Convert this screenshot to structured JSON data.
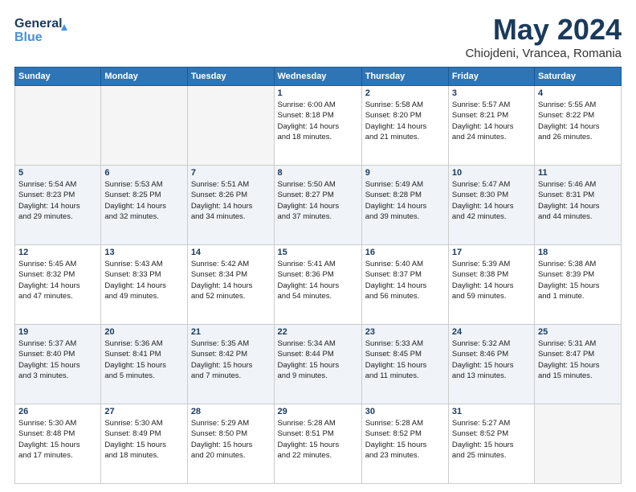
{
  "logo": {
    "line1": "General",
    "line2": "Blue"
  },
  "title": "May 2024",
  "location": "Chiojdeni, Vrancea, Romania",
  "headers": [
    "Sunday",
    "Monday",
    "Tuesday",
    "Wednesday",
    "Thursday",
    "Friday",
    "Saturday"
  ],
  "weeks": [
    [
      {
        "day": "",
        "info": ""
      },
      {
        "day": "",
        "info": ""
      },
      {
        "day": "",
        "info": ""
      },
      {
        "day": "1",
        "info": "Sunrise: 6:00 AM\nSunset: 8:18 PM\nDaylight: 14 hours\nand 18 minutes."
      },
      {
        "day": "2",
        "info": "Sunrise: 5:58 AM\nSunset: 8:20 PM\nDaylight: 14 hours\nand 21 minutes."
      },
      {
        "day": "3",
        "info": "Sunrise: 5:57 AM\nSunset: 8:21 PM\nDaylight: 14 hours\nand 24 minutes."
      },
      {
        "day": "4",
        "info": "Sunrise: 5:55 AM\nSunset: 8:22 PM\nDaylight: 14 hours\nand 26 minutes."
      }
    ],
    [
      {
        "day": "5",
        "info": "Sunrise: 5:54 AM\nSunset: 8:23 PM\nDaylight: 14 hours\nand 29 minutes."
      },
      {
        "day": "6",
        "info": "Sunrise: 5:53 AM\nSunset: 8:25 PM\nDaylight: 14 hours\nand 32 minutes."
      },
      {
        "day": "7",
        "info": "Sunrise: 5:51 AM\nSunset: 8:26 PM\nDaylight: 14 hours\nand 34 minutes."
      },
      {
        "day": "8",
        "info": "Sunrise: 5:50 AM\nSunset: 8:27 PM\nDaylight: 14 hours\nand 37 minutes."
      },
      {
        "day": "9",
        "info": "Sunrise: 5:49 AM\nSunset: 8:28 PM\nDaylight: 14 hours\nand 39 minutes."
      },
      {
        "day": "10",
        "info": "Sunrise: 5:47 AM\nSunset: 8:30 PM\nDaylight: 14 hours\nand 42 minutes."
      },
      {
        "day": "11",
        "info": "Sunrise: 5:46 AM\nSunset: 8:31 PM\nDaylight: 14 hours\nand 44 minutes."
      }
    ],
    [
      {
        "day": "12",
        "info": "Sunrise: 5:45 AM\nSunset: 8:32 PM\nDaylight: 14 hours\nand 47 minutes."
      },
      {
        "day": "13",
        "info": "Sunrise: 5:43 AM\nSunset: 8:33 PM\nDaylight: 14 hours\nand 49 minutes."
      },
      {
        "day": "14",
        "info": "Sunrise: 5:42 AM\nSunset: 8:34 PM\nDaylight: 14 hours\nand 52 minutes."
      },
      {
        "day": "15",
        "info": "Sunrise: 5:41 AM\nSunset: 8:36 PM\nDaylight: 14 hours\nand 54 minutes."
      },
      {
        "day": "16",
        "info": "Sunrise: 5:40 AM\nSunset: 8:37 PM\nDaylight: 14 hours\nand 56 minutes."
      },
      {
        "day": "17",
        "info": "Sunrise: 5:39 AM\nSunset: 8:38 PM\nDaylight: 14 hours\nand 59 minutes."
      },
      {
        "day": "18",
        "info": "Sunrise: 5:38 AM\nSunset: 8:39 PM\nDaylight: 15 hours\nand 1 minute."
      }
    ],
    [
      {
        "day": "19",
        "info": "Sunrise: 5:37 AM\nSunset: 8:40 PM\nDaylight: 15 hours\nand 3 minutes."
      },
      {
        "day": "20",
        "info": "Sunrise: 5:36 AM\nSunset: 8:41 PM\nDaylight: 15 hours\nand 5 minutes."
      },
      {
        "day": "21",
        "info": "Sunrise: 5:35 AM\nSunset: 8:42 PM\nDaylight: 15 hours\nand 7 minutes."
      },
      {
        "day": "22",
        "info": "Sunrise: 5:34 AM\nSunset: 8:44 PM\nDaylight: 15 hours\nand 9 minutes."
      },
      {
        "day": "23",
        "info": "Sunrise: 5:33 AM\nSunset: 8:45 PM\nDaylight: 15 hours\nand 11 minutes."
      },
      {
        "day": "24",
        "info": "Sunrise: 5:32 AM\nSunset: 8:46 PM\nDaylight: 15 hours\nand 13 minutes."
      },
      {
        "day": "25",
        "info": "Sunrise: 5:31 AM\nSunset: 8:47 PM\nDaylight: 15 hours\nand 15 minutes."
      }
    ],
    [
      {
        "day": "26",
        "info": "Sunrise: 5:30 AM\nSunset: 8:48 PM\nDaylight: 15 hours\nand 17 minutes."
      },
      {
        "day": "27",
        "info": "Sunrise: 5:30 AM\nSunset: 8:49 PM\nDaylight: 15 hours\nand 18 minutes."
      },
      {
        "day": "28",
        "info": "Sunrise: 5:29 AM\nSunset: 8:50 PM\nDaylight: 15 hours\nand 20 minutes."
      },
      {
        "day": "29",
        "info": "Sunrise: 5:28 AM\nSunset: 8:51 PM\nDaylight: 15 hours\nand 22 minutes."
      },
      {
        "day": "30",
        "info": "Sunrise: 5:28 AM\nSunset: 8:52 PM\nDaylight: 15 hours\nand 23 minutes."
      },
      {
        "day": "31",
        "info": "Sunrise: 5:27 AM\nSunset: 8:52 PM\nDaylight: 15 hours\nand 25 minutes."
      },
      {
        "day": "",
        "info": ""
      }
    ]
  ]
}
